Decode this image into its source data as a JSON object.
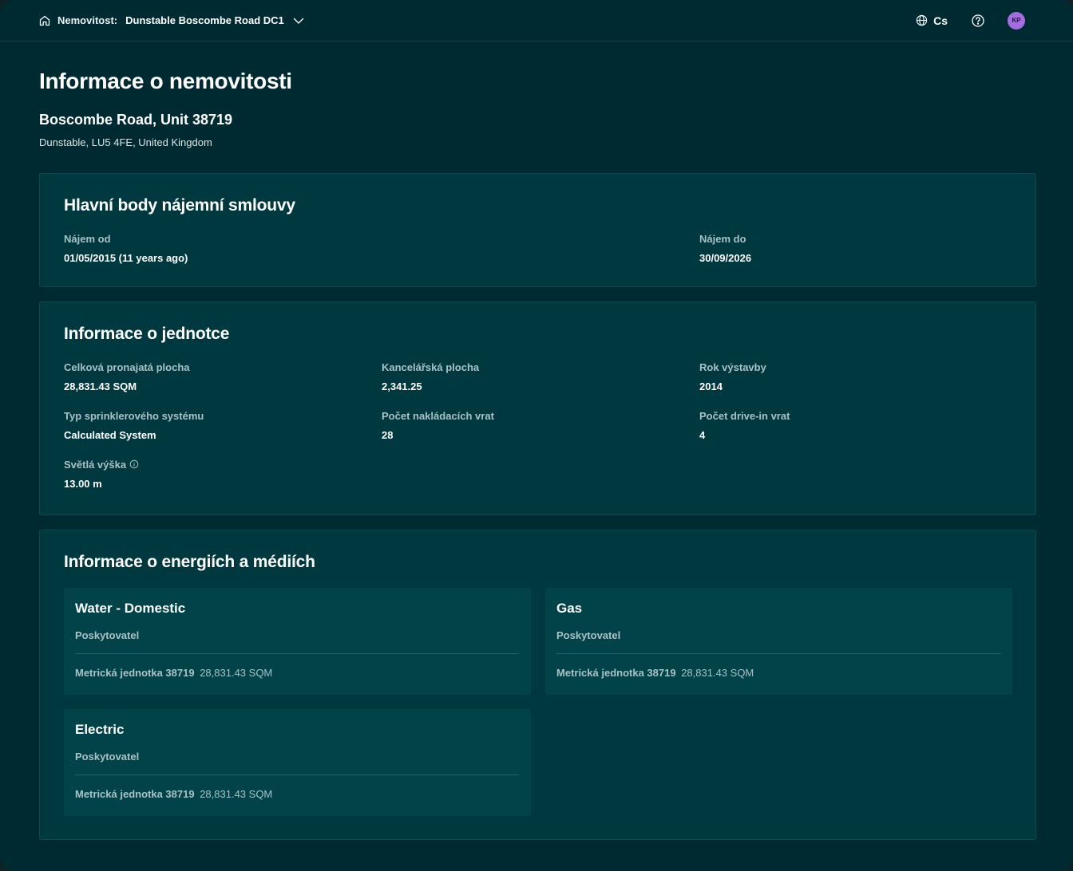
{
  "header": {
    "breadcrumb_label": "Nemovitost:",
    "property_name": "Dunstable Boscombe Road DC1",
    "language": "Cs",
    "avatar_initials": "KP"
  },
  "page": {
    "title": "Informace o nemovitosti",
    "property_name": "Boscombe Road, Unit 38719",
    "address": "Dunstable, LU5 4FE, United Kingdom"
  },
  "lease": {
    "title": "Hlavní body nájemní smlouvy",
    "start_label": "Nájem od",
    "start_value": "01/05/2015 (11 years ago)",
    "end_label": "Nájem do",
    "end_value": "30/09/2026"
  },
  "unit": {
    "title": "Informace o jednotce",
    "fields": [
      {
        "label": "Celková pronajatá plocha",
        "value": "28,831.43 SQM"
      },
      {
        "label": "Kancelářská plocha",
        "value": "2,341.25"
      },
      {
        "label": "Rok výstavby",
        "value": "2014"
      },
      {
        "label": "Typ sprinklerového systému",
        "value": "Calculated System"
      },
      {
        "label": "Počet nakládacích vrat",
        "value": "28"
      },
      {
        "label": "Počet drive-in vrat",
        "value": "4"
      },
      {
        "label": "Světlá výška",
        "value": "13.00 m"
      }
    ]
  },
  "utilities": {
    "title": "Informace o energiích a médiích",
    "items": [
      {
        "name": "Water - Domestic",
        "provider_label": "Poskytovatel",
        "metric_label": "Metrická jednotka 38719",
        "metric_value": "28,831.43 SQM"
      },
      {
        "name": "Gas",
        "provider_label": "Poskytovatel",
        "metric_label": "Metrická jednotka 38719",
        "metric_value": "28,831.43 SQM"
      },
      {
        "name": "Electric",
        "provider_label": "Poskytovatel",
        "metric_label": "Metrická jednotka 38719",
        "metric_value": "28,831.43 SQM"
      }
    ]
  },
  "colors": {
    "background": "#002a31",
    "card": "#003840",
    "utility_card": "#02434a",
    "muted_text": "#a9c2c6",
    "avatar": "#a26ee0"
  }
}
